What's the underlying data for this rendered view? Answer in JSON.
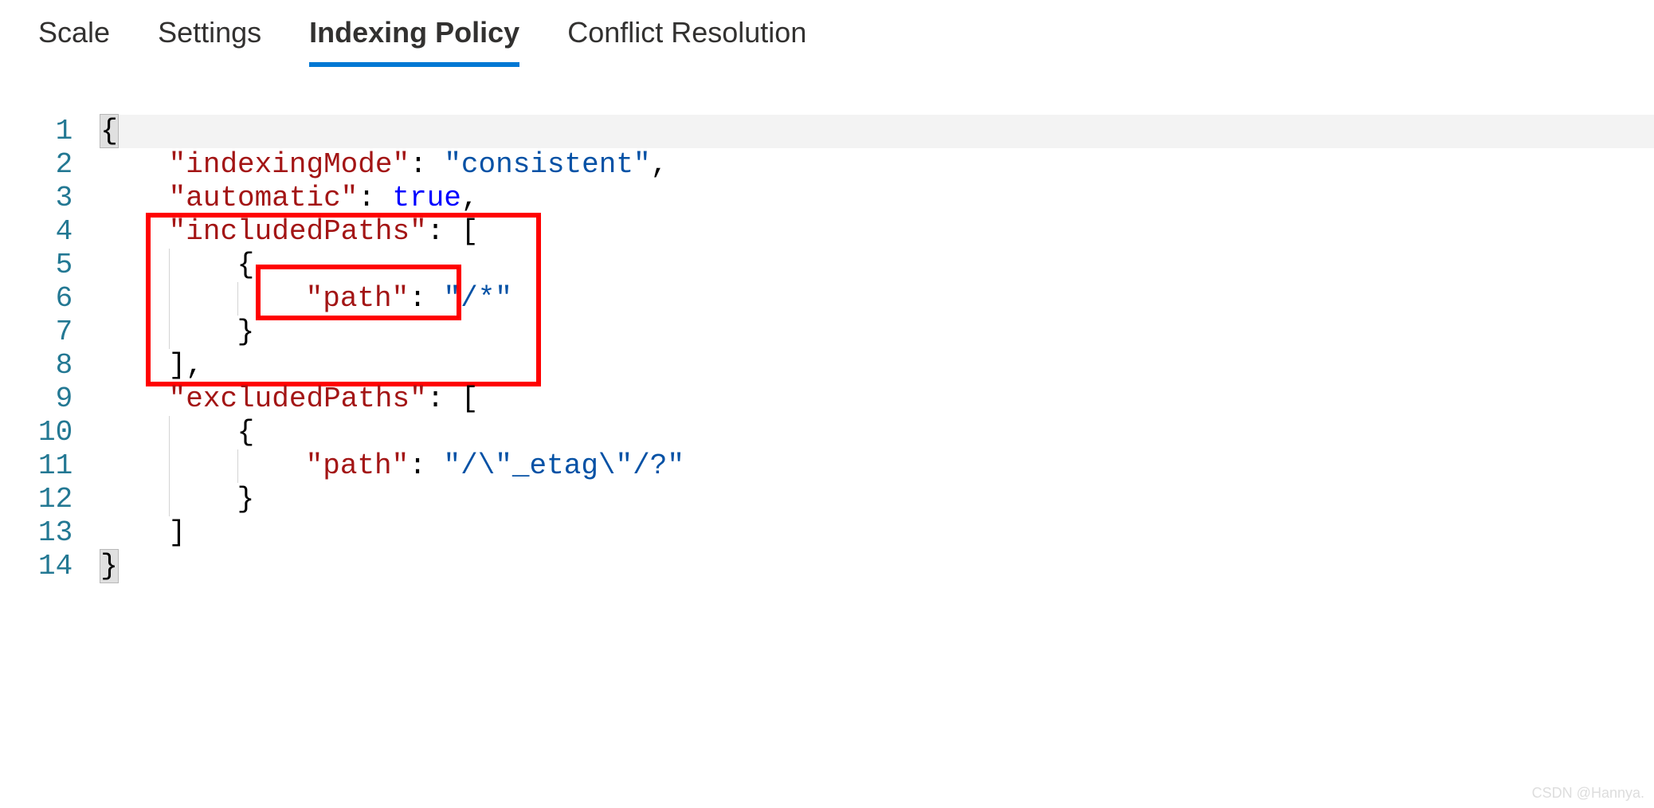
{
  "tabs": {
    "scale": "Scale",
    "settings": "Settings",
    "indexing_policy": "Indexing Policy",
    "conflict_resolution": "Conflict Resolution"
  },
  "line_numbers": [
    "1",
    "2",
    "3",
    "4",
    "5",
    "6",
    "7",
    "8",
    "9",
    "10",
    "11",
    "12",
    "13",
    "14"
  ],
  "code": {
    "l1": "{",
    "l2_key": "\"indexingMode\"",
    "l2_colon": ": ",
    "l2_val": "\"consistent\"",
    "l2_comma": ",",
    "l3_key": "\"automatic\"",
    "l3_colon": ": ",
    "l3_val": "true",
    "l3_comma": ",",
    "l4_key": "\"includedPaths\"",
    "l4_colon": ": [",
    "l5": "{",
    "l6_key": "\"path\"",
    "l6_colon": ": ",
    "l6_val": "\"/*\"",
    "l7": "}",
    "l8": "],",
    "l9_key": "\"excludedPaths\"",
    "l9_colon": ": [",
    "l10": "{",
    "l11_key": "\"path\"",
    "l11_colon": ": ",
    "l11_val": "\"/\\\"_etag\\\"/?\"",
    "l12": "}",
    "l13": "]",
    "l14": "}"
  },
  "watermark": "CSDN @Hannya."
}
